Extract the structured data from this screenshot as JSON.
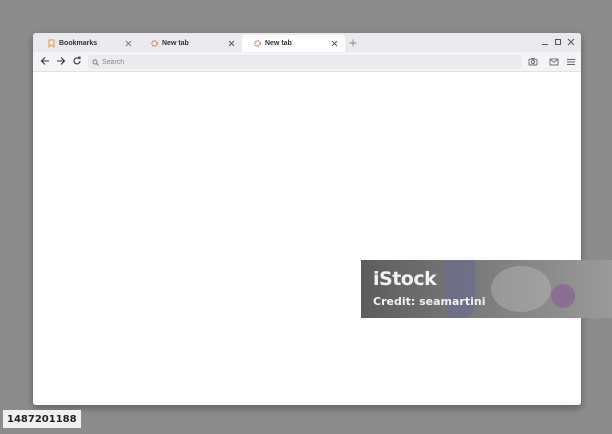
{
  "tabs": [
    {
      "label": "Bookmarks",
      "icon": "bookmark-icon",
      "icon_color": "#f0a020",
      "active": false
    },
    {
      "label": "New tab",
      "icon": "flower-icon",
      "icon_color": "#f06020",
      "active": false
    },
    {
      "label": "New tab",
      "icon": "flower-icon",
      "icon_color": "#f06020",
      "active": true
    }
  ],
  "toolbar": {
    "search_placeholder": "Search",
    "icons": [
      "back-arrow-icon",
      "forward-arrow-icon",
      "reload-icon",
      "search-icon",
      "camera-icon",
      "mail-icon",
      "menu-icon"
    ]
  },
  "window_controls": [
    "minimize-icon",
    "maximize-icon",
    "close-icon"
  ],
  "watermark": {
    "logo": "iStock",
    "credit": "Credit: seamartini"
  },
  "image_id": "1487201188",
  "colors": {
    "page_background": "#8c8c8c",
    "tab_bar": "#e9e9ee",
    "toolbar": "#f4f4f6",
    "accent_orange": "#f06020"
  }
}
